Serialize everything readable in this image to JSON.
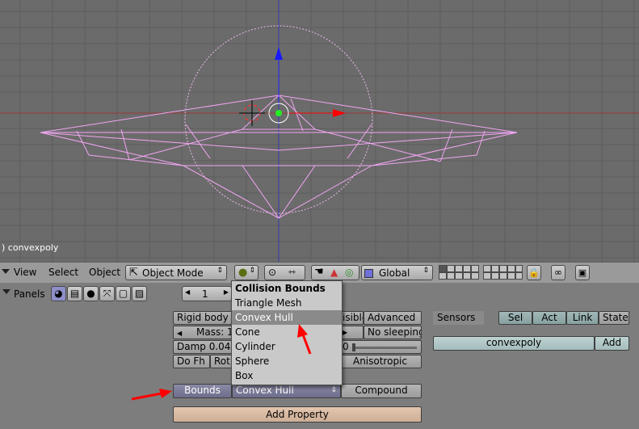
{
  "viewport": {
    "label": ") convexpoly"
  },
  "header": {
    "view": "View",
    "select": "Select",
    "object": "Object",
    "mode": "Object Mode",
    "orientation": "Global"
  },
  "panels_bar": {
    "panels": "Panels",
    "page_number": "1"
  },
  "physics": {
    "rigid_body": "Rigid body",
    "visible": "isible",
    "advanced": "Advanced",
    "mass": "Mass: 1",
    "no_sleeping": "No sleeping",
    "damp": "Damp 0.04",
    "rot_value": "0",
    "do_fh": "Do Fh",
    "rot": "Rot",
    "anisotropic": "Anisotropic",
    "bounds": "Bounds",
    "bounds_value": "Convex Hull",
    "compound": "Compound",
    "add_property": "Add Property"
  },
  "logic": {
    "sensors": "Sensors",
    "sel": "Sel",
    "act": "Act",
    "link": "Link",
    "state": "State",
    "object_name": "convexpoly",
    "add": "Add"
  },
  "collision_menu": {
    "title": "Collision Bounds",
    "items": [
      "Triangle Mesh",
      "Convex Hull",
      "Cone",
      "Cylinder",
      "Sphere",
      "Box"
    ],
    "selected": "Convex Hull"
  },
  "colors": {
    "wire": "#f2a6f2",
    "annotation": "#ff0000",
    "menu_highlight": "#8a8a8a"
  }
}
